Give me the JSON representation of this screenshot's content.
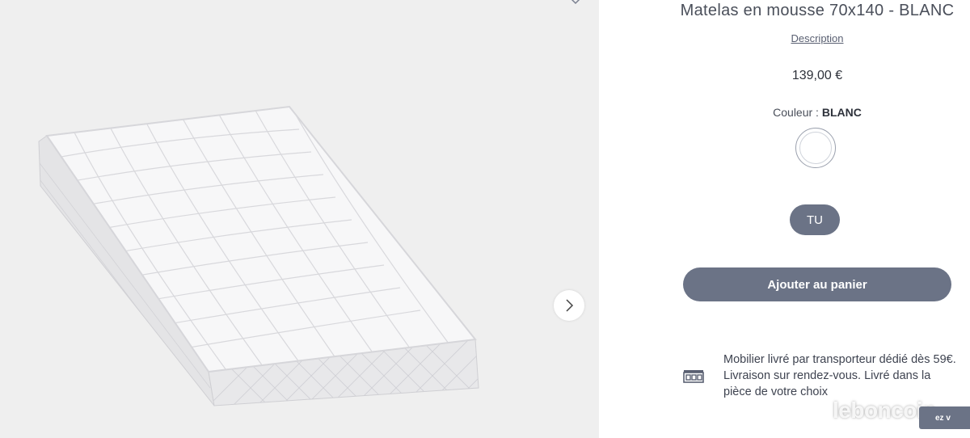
{
  "product": {
    "title": "Matelas en mousse 70x140 - BLANC",
    "description_link": "Description",
    "price": "139,00 €",
    "color_label": "Couleur :",
    "color_value": "BLANC",
    "size_option": "TU",
    "add_to_cart": "Ajouter au panier",
    "delivery_text": "Mobilier livré par transporteur dédié dès 59€. Livraison sur rendez-vous. Livré dans la pièce de votre choix"
  },
  "watermark": "leboncoin",
  "corner_button": "ez v",
  "icons": {
    "next": "chevron-right-icon",
    "collapse": "chevron-down-icon",
    "delivery": "delivery-truck-icon"
  },
  "colors": {
    "accent": "#6b7386",
    "gallery_bg": "#efefef"
  }
}
